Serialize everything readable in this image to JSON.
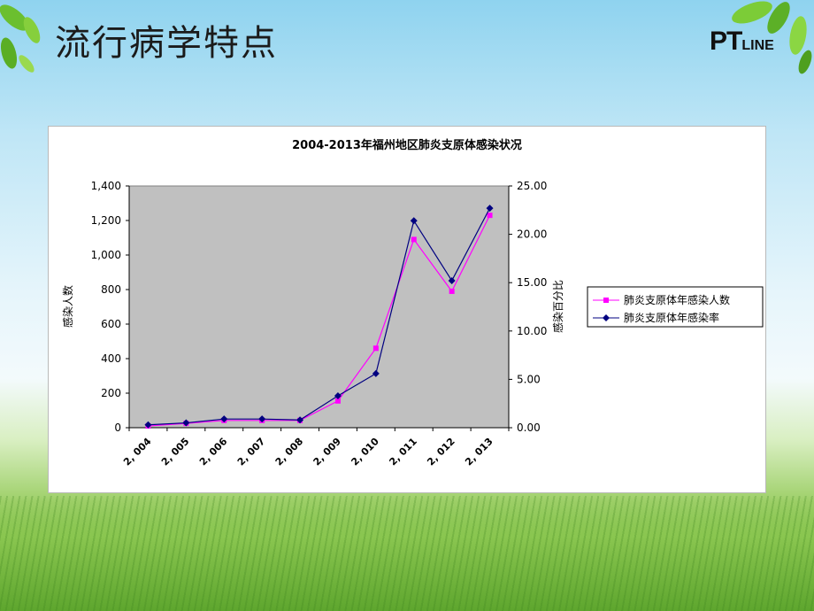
{
  "slide": {
    "title": "流行病学特点",
    "logo_bold": "PT",
    "logo_light": "LINE"
  },
  "colors": {
    "plot_bg": "#c0c0c0",
    "series_count": "#ff00ff",
    "series_rate": "#000080"
  },
  "chart_data": {
    "type": "line",
    "title": "2004-2013年福州地区肺炎支原体感染状况",
    "categories": [
      "2, 004",
      "2, 005",
      "2, 006",
      "2, 007",
      "2, 008",
      "2, 009",
      "2, 010",
      "2, 011",
      "2, 012",
      "2, 013"
    ],
    "ylabel": "感染人数",
    "y2label": "感染百分比",
    "ylim": [
      0,
      1400
    ],
    "y2lim": [
      0,
      25
    ],
    "yticks": [
      "0",
      "200",
      "400",
      "600",
      "800",
      "1,000",
      "1,200",
      "1,400"
    ],
    "y2ticks": [
      "0.00",
      "5.00",
      "10.00",
      "15.00",
      "20.00",
      "25.00"
    ],
    "legend_position": "right",
    "series": [
      {
        "name": "肺炎支原体年感染人数",
        "axis": "left",
        "marker": "square",
        "color": "#ff00ff",
        "values": [
          10,
          25,
          42,
          42,
          42,
          155,
          460,
          1090,
          790,
          1230
        ]
      },
      {
        "name": "肺炎支原体年感染率",
        "axis": "right",
        "marker": "diamond",
        "color": "#000080",
        "values": [
          0.3,
          0.5,
          0.9,
          0.9,
          0.8,
          3.3,
          5.6,
          21.4,
          15.2,
          22.7
        ]
      }
    ]
  }
}
